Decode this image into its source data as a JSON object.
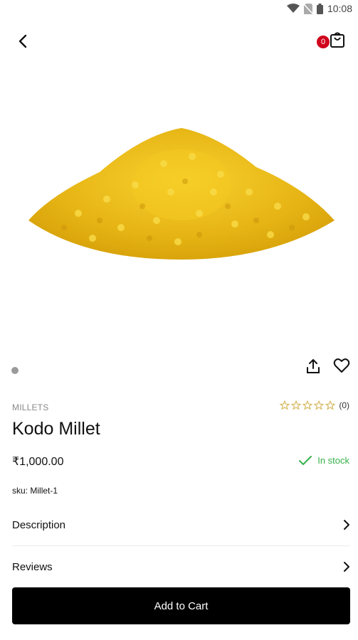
{
  "status_bar": {
    "time": "10:08"
  },
  "header": {
    "cart_count": "0"
  },
  "product": {
    "category": "MILLETS",
    "title": "Kodo Millet",
    "price": "₹1,000.00",
    "rating_count": "(0)",
    "rating": 0,
    "stock_status": "In stock",
    "sku_label": "sku:",
    "sku": "Millet-1"
  },
  "sections": {
    "description_label": "Description",
    "reviews_label": "Reviews"
  },
  "actions": {
    "add_to_cart": "Add to Cart"
  },
  "colors": {
    "accent": "#000000",
    "badge": "#d0021b",
    "stock": "#38b24a",
    "star": "#d4b65b"
  }
}
